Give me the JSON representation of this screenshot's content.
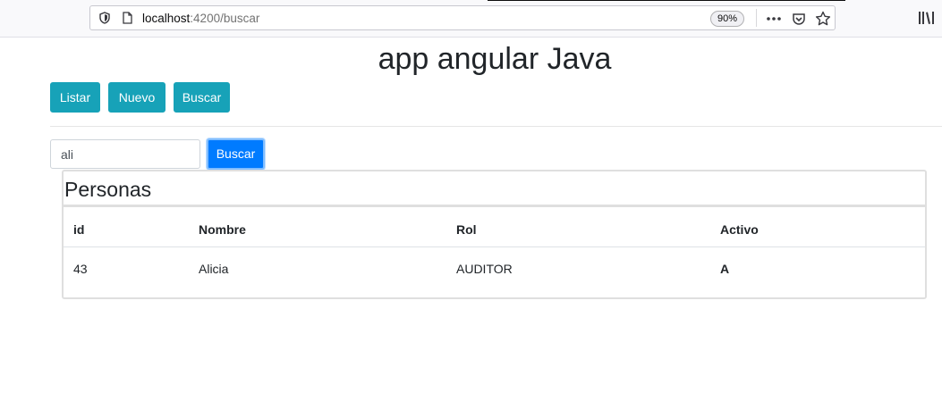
{
  "browser": {
    "url_host": "localhost",
    "url_path": ":4200/buscar",
    "zoom": "90%"
  },
  "app": {
    "title": "app angular Java"
  },
  "nav": {
    "buttons": [
      {
        "label": "Listar"
      },
      {
        "label": "Nuevo"
      },
      {
        "label": "Buscar"
      }
    ]
  },
  "search": {
    "value": "ali",
    "button_label": "Buscar"
  },
  "card": {
    "title": "Personas",
    "columns": [
      "id",
      "Nombre",
      "Rol",
      "Activo"
    ],
    "rows": [
      [
        "43",
        "Alicia",
        "AUDITOR",
        "A"
      ]
    ]
  },
  "colors": {
    "info": "#17a2b8",
    "primary": "#007bff"
  }
}
